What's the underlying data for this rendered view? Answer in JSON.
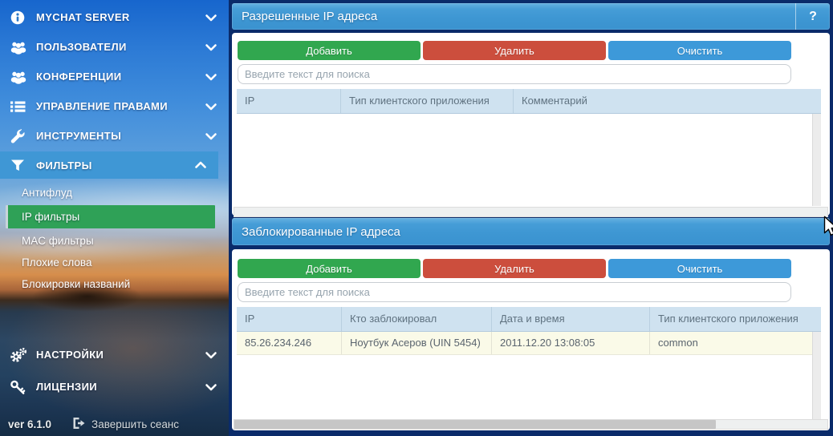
{
  "colors": {
    "navy_frame": "#0a2b6a",
    "header_blue": "#3e97d3",
    "sidebar_active_blue": "#3f97d5",
    "selected_green": "#2fa157",
    "button_green": "#31a74f",
    "button_red": "#cc4e3d",
    "button_blue": "#3d99d9",
    "table_header_bg": "#cfe2f0",
    "row_highlight_bg": "#fafae8"
  },
  "sidebar": {
    "items": [
      {
        "label": "MYCHAT SERVER",
        "icon": "info-icon",
        "chevron": "down"
      },
      {
        "label": "ПОЛЬЗОВАТЕЛИ",
        "icon": "users-icon",
        "chevron": "down"
      },
      {
        "label": "КОНФЕРЕНЦИИ",
        "icon": "conference-icon",
        "chevron": "down"
      },
      {
        "label": "УПРАВЛЕНИЕ ПРАВАМИ",
        "icon": "list-icon",
        "chevron": "down"
      },
      {
        "label": "ИНСТРУМЕНТЫ",
        "icon": "wrench-icon",
        "chevron": "down"
      },
      {
        "label": "ФИЛЬТРЫ",
        "icon": "filter-icon",
        "chevron": "up",
        "expanded": true
      },
      {
        "label": "НАСТРОЙКИ",
        "icon": "gears-icon",
        "chevron": "down"
      },
      {
        "label": "ЛИЦЕНЗИИ",
        "icon": "key-icon",
        "chevron": "down"
      }
    ],
    "filters_submenu": {
      "items": [
        {
          "label": "Антифлуд"
        },
        {
          "label": "IP фильтры",
          "selected": true
        },
        {
          "label": "MAC фильтры"
        },
        {
          "label": "Плохие слова"
        },
        {
          "label": "Блокировки названий"
        }
      ]
    },
    "footer": {
      "version": "ver 6.1.0",
      "logout_label": "Завершить сеанс"
    }
  },
  "panels": [
    {
      "title": "Разрешенные IP адреса",
      "help_label": "?",
      "buttons": {
        "add": "Добавить",
        "remove": "Удалить",
        "clear": "Очистить"
      },
      "search_placeholder": "Введите текст для поиска",
      "table": {
        "columns": [
          "IP",
          "Тип клиентского приложения",
          "Комментарий"
        ],
        "rows": []
      }
    },
    {
      "title": "Заблокированные IP адреса",
      "buttons": {
        "add": "Добавить",
        "remove": "Удалить",
        "clear": "Очистить"
      },
      "search_placeholder": "Введите текст для поиска",
      "table": {
        "columns": [
          "IP",
          "Кто заблокировал",
          "Дата и время",
          "Тип клиентского приложения"
        ],
        "rows": [
          [
            "85.26.234.246",
            "Ноутбук Асеров (UIN 5454)",
            "2011.12.20 13:08:05",
            "common"
          ]
        ]
      }
    }
  ]
}
